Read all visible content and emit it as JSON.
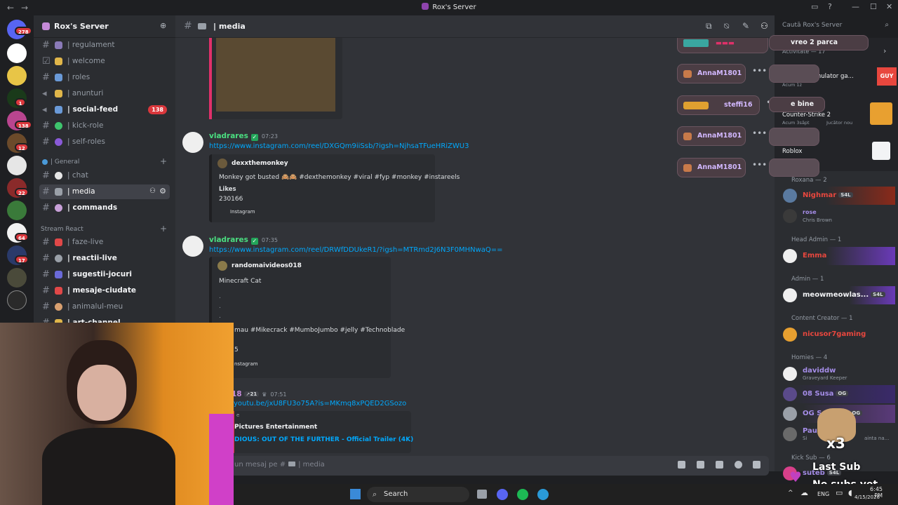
{
  "window": {
    "title": "Rox's Server",
    "back": "←",
    "forward": "→"
  },
  "guilds": {
    "badges": [
      "278",
      "1",
      "138",
      "12",
      "22",
      "64",
      "17"
    ]
  },
  "server": {
    "name": "Rox's Server",
    "channels_top": [
      {
        "label": "| regulament",
        "bold": false
      },
      {
        "label": "| welcome",
        "bold": false
      },
      {
        "label": "| roles",
        "bold": false
      },
      {
        "label": "| anunturi",
        "bold": false
      },
      {
        "label": "| social-feed",
        "bold": true,
        "badge": "138"
      },
      {
        "label": "| kick-role",
        "bold": false
      },
      {
        "label": "| self-roles",
        "bold": false
      }
    ],
    "category_general": "| General",
    "channels_general": [
      {
        "label": "| chat"
      },
      {
        "label": "| media"
      },
      {
        "label": "| commands"
      }
    ],
    "category_stream": "Stream React",
    "channels_stream": [
      {
        "label": "| faze-live",
        "bold": false
      },
      {
        "label": "| reactii-live",
        "bold": true
      },
      {
        "label": "| sugestii-jocuri",
        "bold": true
      },
      {
        "label": "| mesaje-ciudate",
        "bold": true
      },
      {
        "label": "| animalul-meu",
        "bold": false
      },
      {
        "label": "| art-channel",
        "bold": true
      }
    ]
  },
  "channel_header": {
    "name": "| media"
  },
  "search": {
    "placeholder": "Caută Rox's Server"
  },
  "messages": [
    {
      "author": "vladrares",
      "time": "07:23",
      "link": "https://www.instagram.com/reel/DXGQm9iiSsb/?igsh=NjhsaTFueHRiZWU3",
      "embed_author": "dexxthemonkey",
      "embed_text": "Monkey got busted 🙈🙈 #dexthemonkey #viral #fyp #monkey #instareels",
      "likes_label": "Likes",
      "likes_value": "230166",
      "footer": "Instagram"
    },
    {
      "author": "vladrares",
      "time": "07:35",
      "link": "https://www.instagram.com/reel/DRWfDDUkeR1/?igsh=MTRmd2J6N3F0MHNwaQ==",
      "embed_author": "randomaivideos018",
      "embed_text": "Minecraft Cat",
      "dots": ".",
      "embed_tags": "mau #Mikecrack #MumboJumbo #jelly #Technoblade",
      "partial_value": "5",
      "footer": "nstagram"
    },
    {
      "author_partial": "18",
      "boost": "21",
      "time": "07:51",
      "link": "youtu.be/jxU8FU3o75A?is=MKmq8xPQED2GSozo",
      "embed_provider_partial": "e",
      "embed_author": "Pictures Entertainment",
      "embed_title": "DIOUS: OUT OF THE FURTHER - Official Trailer (4K)"
    }
  ],
  "composer": {
    "placeholder_start": "un mesaj pe #",
    "placeholder_channel": "| media"
  },
  "floating_users": [
    {
      "name": "vreo 2 parca"
    },
    {
      "name": "AnnaM1801"
    },
    {
      "name": "steffi16"
    },
    {
      "name": "AnnaM1801"
    },
    {
      "name": "AnnaM1801"
    },
    {
      "name": "e bine"
    }
  ],
  "activity": {
    "header": "Activitate — 17",
    "items": [
      {
        "title": "ile Guy... Simulator ga...",
        "sub": "Acum 1z"
      },
      {
        "title": "Counter-Strike 2",
        "sub": "Acum 3săpt",
        "sub2": "Jucător nou"
      },
      {
        "title": "Roblox",
        "sub": "slaay"
      }
    ]
  },
  "members": {
    "groups": [
      {
        "label": "Roxana — 2",
        "members": [
          {
            "name": "Nighmar",
            "tag": "S4L",
            "color": "#e8473e"
          },
          {
            "name": "rose",
            "sub": "Chris Brown",
            "color": "#a58de8"
          }
        ]
      },
      {
        "label": "Head Admin — 1",
        "members": [
          {
            "name": "Emma",
            "color": "#e8473e"
          }
        ]
      },
      {
        "label": "Admin — 1",
        "members": [
          {
            "name": "meowmeowlas...",
            "tag": "S4L",
            "color": "#f2f3f5"
          }
        ]
      },
      {
        "label": "Content Creator — 1",
        "members": [
          {
            "name": "nicusor7gaming",
            "color": "#e8473e"
          }
        ]
      },
      {
        "label": "Homies — 4",
        "members": [
          {
            "name": "daviddw",
            "sub": "Graveyard Keeper",
            "color": "#a58de8"
          },
          {
            "name": "08 Susa",
            "tag": "OG",
            "color": "#a58de8"
          },
          {
            "name": "OG S",
            "tag": "OG",
            "color": "#a58de8"
          },
          {
            "name": "Paul",
            "sub": "Si",
            "sub_end": "ainta na...",
            "color": "#a58de8"
          }
        ]
      },
      {
        "label": "Kick Sub — 6",
        "members": [
          {
            "name": "suteb",
            "tag": "S4L",
            "color": "#a58de8"
          }
        ]
      }
    ]
  },
  "overlay": {
    "multiplier": "x3",
    "last_sub": "Last Sub",
    "no_subs": "No subs yet"
  },
  "taskbar": {
    "search": "Search",
    "lang": "ENG",
    "time": "6:45 PM",
    "date": "4/15/2026"
  },
  "colors": {
    "accent_link": "#00a8fc",
    "bot_green": "#23a55a",
    "badge_red": "#da373c"
  }
}
